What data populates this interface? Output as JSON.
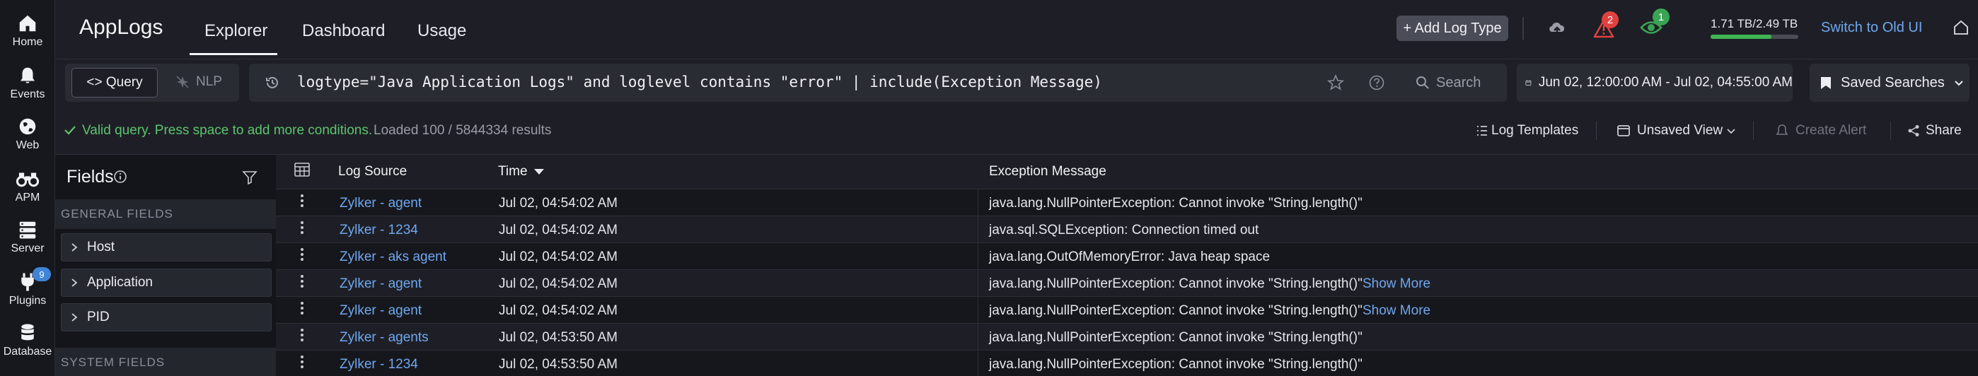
{
  "rail": {
    "items": [
      {
        "label": "Home",
        "icon": "home-icon"
      },
      {
        "label": "Events",
        "icon": "bell-icon"
      },
      {
        "label": "Web",
        "icon": "globe-icon"
      },
      {
        "label": "APM",
        "icon": "binoculars-icon"
      },
      {
        "label": "Server",
        "icon": "server-icon"
      },
      {
        "label": "Plugins",
        "icon": "plug-icon",
        "badge": "9"
      },
      {
        "label": "Database",
        "icon": "database-icon"
      }
    ]
  },
  "header": {
    "app_title": "AppLogs",
    "tabs": [
      "Explorer",
      "Dashboard",
      "Usage"
    ],
    "active_tab": "Explorer",
    "add_log_type": "+ Add Log Type",
    "alert_count": "2",
    "watch_count": "1",
    "storage": "1.71 TB/2.49 TB",
    "storage_fraction": 0.69,
    "switch_ui": "Switch to Old UI"
  },
  "query": {
    "mode_query": "<> Query",
    "mode_nlp": "NLP",
    "text": "logtype=\"Java Application Logs\" and loglevel contains \"error\" | include(Exception Message)",
    "search_label": "Search",
    "time_range": "Jun 02, 12:00:00 AM - Jul 02, 04:55:00 AM",
    "saved_searches": "Saved Searches"
  },
  "status": {
    "valid_msg": "Valid query. Press space to add more conditions.",
    "loaded": "Loaded 100 / 5844334 results",
    "log_templates": "Log Templates",
    "unsaved_view": "Unsaved View",
    "create_alert": "Create Alert",
    "share": "Share"
  },
  "fields": {
    "title": "Fields",
    "general_heading": "GENERAL FIELDS",
    "general": [
      "Host",
      "Application",
      "PID"
    ],
    "system_heading": "SYSTEM FIELDS"
  },
  "table": {
    "columns": [
      "Log Source",
      "Time",
      "Exception Message"
    ],
    "show_more": "Show More",
    "rows": [
      {
        "source": "Zylker - agent",
        "time": "Jul 02, 04:54:02 AM",
        "message": "java.lang.NullPointerException: Cannot invoke \"String.length()\"",
        "more": false
      },
      {
        "source": "Zylker - 1234",
        "time": "Jul 02, 04:54:02 AM",
        "message": "java.sql.SQLException: Connection timed out",
        "more": false
      },
      {
        "source": "Zylker - aks agent",
        "time": "Jul 02, 04:54:02 AM",
        "message": "java.lang.OutOfMemoryError: Java heap space",
        "more": false
      },
      {
        "source": "Zylker - agent",
        "time": "Jul 02, 04:54:02 AM",
        "message": "java.lang.NullPointerException: Cannot invoke \"String.length()\"",
        "more": true
      },
      {
        "source": "Zylker - agent",
        "time": "Jul 02, 04:54:02 AM",
        "message": "java.lang.NullPointerException: Cannot invoke \"String.length()\"",
        "more": true
      },
      {
        "source": "Zylker - agents",
        "time": "Jul 02, 04:53:50 AM",
        "message": "java.lang.NullPointerException: Cannot invoke \"String.length()\"",
        "more": false
      },
      {
        "source": "Zylker - 1234",
        "time": "Jul 02, 04:53:50 AM",
        "message": "java.lang.NullPointerException: Cannot invoke \"String.length()\"",
        "more": false
      }
    ]
  },
  "colors": {
    "accent_link": "#6fa7ef",
    "valid_green": "#5cc46e",
    "alert_red": "#e0413f",
    "watch_green": "#3aa455"
  }
}
